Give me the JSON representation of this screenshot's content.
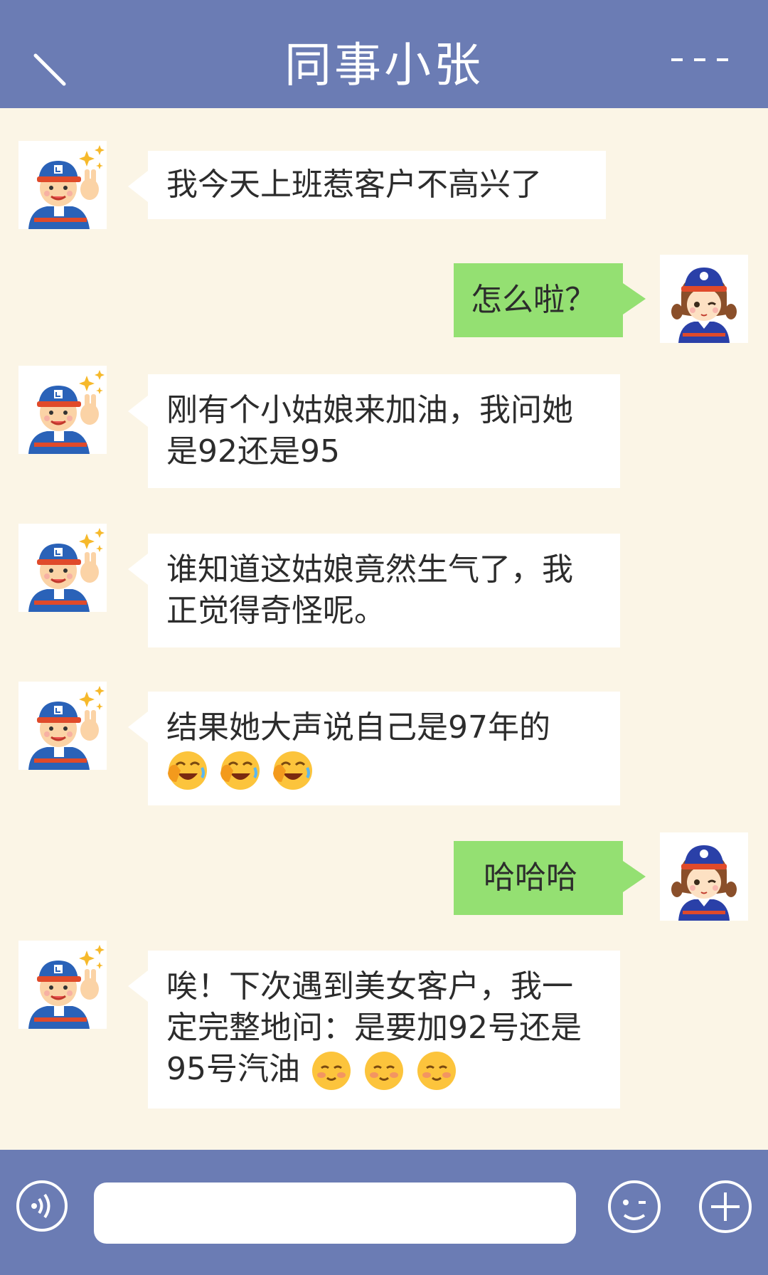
{
  "header": {
    "title": "同事小张",
    "back_icon": "back-arrow-icon",
    "more_icon": "more-dots-icon",
    "background": "#6b7cb4"
  },
  "messages": [
    {
      "side": "left",
      "sender": "同事小张",
      "avatar": "worker-boy-avatar",
      "text": "我今天上班惹客户不高兴了",
      "emojis": []
    },
    {
      "side": "right",
      "sender": "me",
      "avatar": "worker-girl-avatar",
      "text": "怎么啦？",
      "emojis": []
    },
    {
      "side": "left",
      "sender": "同事小张",
      "avatar": "worker-boy-avatar",
      "text": "刚有个小姑娘来加油，我问她是92还是95",
      "emojis": []
    },
    {
      "side": "left",
      "sender": "同事小张",
      "avatar": "worker-boy-avatar",
      "text": "谁知道这姑娘竟然生气了，我正觉得奇怪呢。",
      "emojis": []
    },
    {
      "side": "left",
      "sender": "同事小张",
      "avatar": "worker-boy-avatar",
      "text": "结果她大声说自己是97年的",
      "emojis": [
        "facepalm-laugh-emoji",
        "facepalm-laugh-emoji",
        "facepalm-laugh-emoji"
      ]
    },
    {
      "side": "right",
      "sender": "me",
      "avatar": "worker-girl-avatar",
      "text": "哈哈哈",
      "emojis": []
    },
    {
      "side": "left",
      "sender": "同事小张",
      "avatar": "worker-boy-avatar",
      "text": "唉！下次遇到美女客户，我一定完整地问：是要加92号还是95号汽油",
      "emojis": [
        "blush-emoji",
        "blush-emoji",
        "blush-emoji"
      ]
    }
  ],
  "footer": {
    "voice_icon": "voice-icon",
    "emoji_icon": "emoji-face-icon",
    "plus_icon": "plus-icon",
    "input_value": "",
    "background": "#6b7cb4"
  },
  "colors": {
    "chat_background": "#fbf5e6",
    "left_bubble": "#ffffff",
    "right_bubble": "#94e072"
  }
}
